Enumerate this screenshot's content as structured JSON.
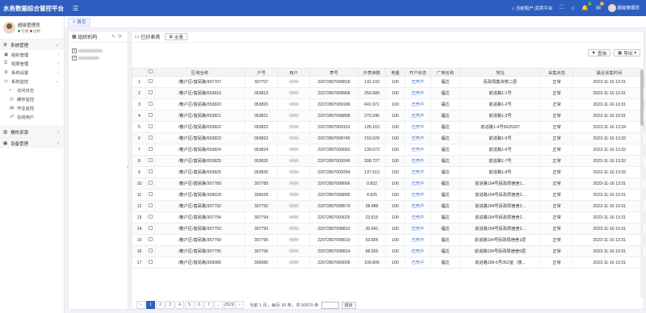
{
  "app": {
    "title": "水务数据综合管控平台",
    "menu_icon": "hamburger-icon"
  },
  "topbar": {
    "tenant_label": "当前租户:",
    "tenant_value": "武宾平台",
    "notif_count": "1",
    "mail_count": "5",
    "user_name": "超级管理员"
  },
  "user": {
    "name": "超级管理员",
    "status_online": "在线",
    "status_logout": "注销"
  },
  "sidebar": {
    "system_mgmt": "系统管理",
    "items": [
      "组织管理",
      "权限管理",
      "系统设置",
      "系统监控"
    ],
    "monitor_subs": [
      "访问日志",
      "缓存监控",
      "作业监控",
      "在线用户"
    ],
    "building": "楼栋资源",
    "device": "设备管理"
  },
  "tabs": {
    "home": "首页"
  },
  "left_panel": {
    "title": "组织机构"
  },
  "main_panel": {
    "title": "已抄表具",
    "water_btn": "水表",
    "query_btn": "查询",
    "export_btn": "导出"
  },
  "table": {
    "headers": [
      "",
      "区域全称",
      "户号",
      "用户",
      "表号",
      "抄表读数",
      "电量",
      "开户状态",
      "厂商名称",
      "地址",
      "采集状态",
      "最近采集时间"
    ],
    "rows": [
      [
        "1",
        "/散户区/富民路/307707",
        "307707",
        "",
        "22072807008818",
        "132.103",
        "100",
        "已开户",
        "福达",
        "民政局集资楼二层",
        "正常",
        "2023-11-16 13:31"
      ],
      [
        "2",
        "/散户区/富民路/053819",
        "053819",
        "",
        "22072807008958",
        "250.689",
        "100",
        "已开户",
        "福达",
        "前进路1-1号",
        "正常",
        "2023-11-16 13:31"
      ],
      [
        "3",
        "/散户区/富民路/053820",
        "053820",
        "",
        "22072807009186",
        "641.971",
        "100",
        "已开户",
        "福达",
        "前进路1-2号",
        "正常",
        "2023-11-16 13:31"
      ],
      [
        "4",
        "/散户区/富民路/053821",
        "053821",
        "",
        "22072807008858",
        "270.246",
        "100",
        "已开户",
        "福达",
        "前进路1-3号",
        "正常",
        "2023-11-16 13:31"
      ],
      [
        "5",
        "/散户区/富民路/053822",
        "053822",
        "",
        "22072807009191",
        "128.163",
        "100",
        "已开户",
        "福达",
        "前进路1-4号5625307",
        "正常",
        "2023-11-16 13:34"
      ],
      [
        "6",
        "/散户区/富民路/053823",
        "053823",
        "",
        "22072807008745",
        "153.029",
        "100",
        "已开户",
        "福达",
        "前进路1-5号",
        "正常",
        "2023-11-16 13:32"
      ],
      [
        "7",
        "/散户区/富民路/053824",
        "053824",
        "",
        "22072807009060",
        "139.073",
        "100",
        "已开户",
        "福达",
        "前进路1-6号",
        "正常",
        "2023-11-16 13:32"
      ],
      [
        "8",
        "/散户区/富民路/053825",
        "053825",
        "",
        "22072807009245",
        "208.727",
        "100",
        "已开户",
        "福达",
        "前进路1-7号",
        "正常",
        "2023-11-16 13:32"
      ],
      [
        "9",
        "/散户区/富民路/053826",
        "053826",
        "",
        "22072807009254",
        "137.513",
        "100",
        "已开户",
        "福达",
        "前进路1-8号",
        "正常",
        "2023-11-16 13:33"
      ],
      [
        "10",
        "/散户区/富民路/307789",
        "307789",
        "",
        "22072807008666",
        "0.822",
        "100",
        "已开户",
        "福达",
        "前进路194号民政局宿舍1...",
        "正常",
        "2023-11-16 13:31"
      ],
      [
        "11",
        "/散户区/富民路/309028",
        "309028",
        "",
        "22072807008895",
        "4.925",
        "100",
        "已开户",
        "福达",
        "前进路194号民政局宿舍2...",
        "正常",
        "2023-11-16 13:31"
      ],
      [
        "12",
        "/散户区/富民路/307792",
        "307792",
        "",
        "22072807008579",
        "38.488",
        "100",
        "已开户",
        "福达",
        "前进路194号民政局宿舍2...",
        "正常",
        "2023-11-16 13:31"
      ],
      [
        "13",
        "/散户区/富民路/307794",
        "307794",
        "",
        "22072807009025",
        "23.815",
        "100",
        "已开户",
        "福达",
        "前进路194号民政局宿舍2...",
        "正常",
        "2023-11-16 13:31"
      ],
      [
        "14",
        "/散户区/富民路/307793",
        "307793",
        "",
        "22072807008812",
        "30.941",
        "100",
        "已开户",
        "福达",
        "前进路194号民政局宿舍2...",
        "正常",
        "2023-11-16 13:31"
      ],
      [
        "15",
        "/散户区/富民路/307790",
        "307790",
        "",
        "22072807008619",
        "53.805",
        "100",
        "已开户",
        "福达",
        "前进路194号民政局宿舍1层",
        "正常",
        "2023-11-16 13:31"
      ],
      [
        "16",
        "/散户区/富民路/307795",
        "307795",
        "",
        "22072807008814",
        "98.925",
        "100",
        "已开户",
        "福达",
        "前进路194号民政局宿舍6层",
        "正常",
        "2023-11-16 13:31"
      ],
      [
        "17",
        "/散户区/富民路/309085",
        "309085",
        "",
        "22072807009009",
        "109.806",
        "100",
        "已开户",
        "福达",
        "前进路196-5号302室（楼...",
        "正常",
        "2023-11-16 13:31"
      ]
    ]
  },
  "pager": {
    "pages": [
      "1",
      "2",
      "3",
      "4",
      "5",
      "6",
      "7",
      "...",
      "2529"
    ],
    "current_label": "当前",
    "page_unit": "页，每页",
    "per_page": "20",
    "total_label": "条，共 50570 条",
    "go_label": "跳转"
  }
}
